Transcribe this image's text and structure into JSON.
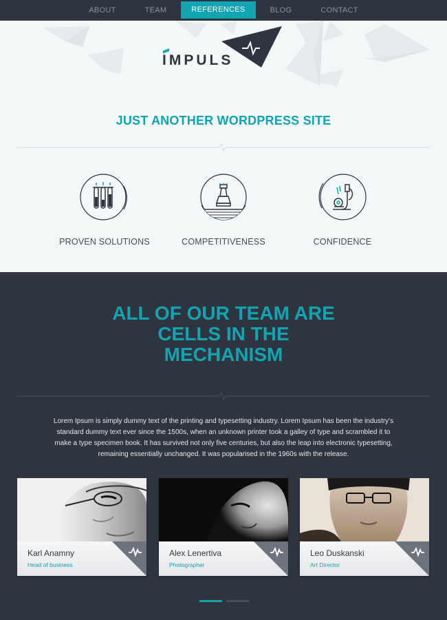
{
  "nav": {
    "items": [
      {
        "label": "ABOUT"
      },
      {
        "label": "TEAM"
      },
      {
        "label": "REFERENCES"
      },
      {
        "label": "BLOG"
      },
      {
        "label": "CONTACT"
      }
    ],
    "active_index": 2
  },
  "hero": {
    "logo_text": "IMPULS",
    "title": "JUST ANOTHER WORDPRESS SITE",
    "features": [
      {
        "label": "PROVEN SOLUTIONS",
        "icon": "test-tubes-icon"
      },
      {
        "label": "COMPETITIVENESS",
        "icon": "chess-rook-icon"
      },
      {
        "label": "CONFIDENCE",
        "icon": "microscope-icon"
      }
    ]
  },
  "team": {
    "title_lines": [
      "ALL OF OUR TEAM ARE",
      "CELLS IN THE",
      "MECHANISM"
    ],
    "description": "Lorem Ipsum is simply dummy text of the printing and typesetting industry. Lorem Ipsum has been the industry's standard dummy text ever since the 1500s, when an unknown printer took a galley of type and scrambled it to make a type specimen book. It has survived not only five centuries, but also the leap into electronic typesetting, remaining essentially unchanged. It was popularised in the 1960s with the release.",
    "members": [
      {
        "name": "Karl Anamny",
        "role": "Head of business"
      },
      {
        "name": "Alex Lenertiva",
        "role": "Photographer"
      },
      {
        "name": "Leo Duskanski",
        "role": "Art Director"
      }
    ],
    "pager": {
      "pages": 2,
      "active": 1
    }
  },
  "colors": {
    "accent": "#12a4b0",
    "dark": "#2f3540",
    "light": "#f4f7f8"
  }
}
